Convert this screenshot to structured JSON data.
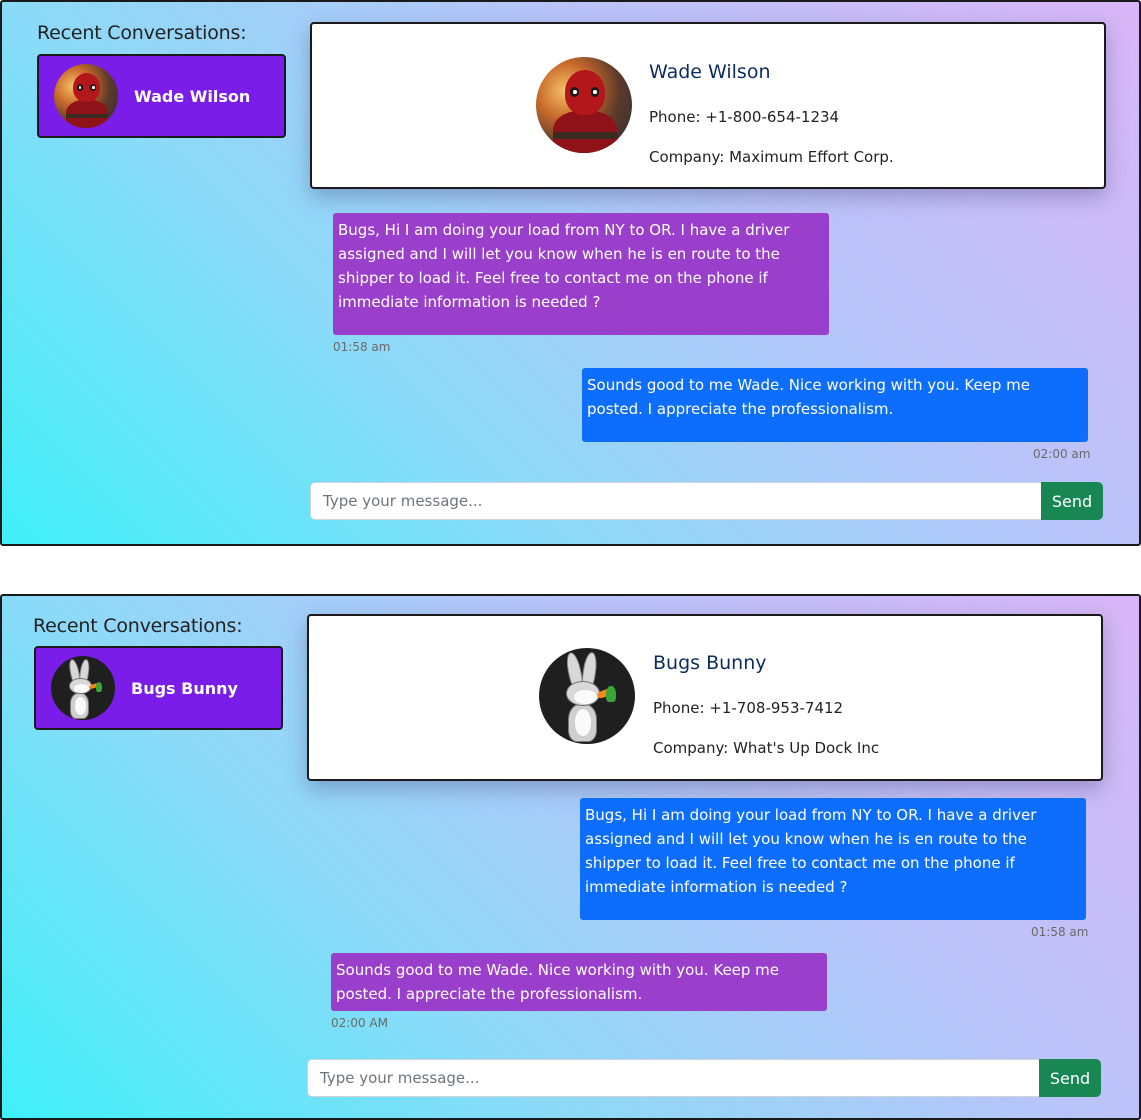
{
  "panels": [
    {
      "recent_title": "Recent Conversations:",
      "conversation": {
        "name": "Wade Wilson",
        "avatar": "deadpool-avatar"
      },
      "profile": {
        "name": "Wade Wilson",
        "phone": "Phone: +1-800-654-1234",
        "company": "Company: Maximum Effort Corp."
      },
      "messages": [
        {
          "text": "Bugs, Hi I am doing your load from NY to OR. I have a driver assigned and I will let you know when he is en route to the shipper to load it. Feel free to contact me on the phone if immediate information is needed ?",
          "time": "01:58 am",
          "side": "left",
          "color": "#9a3fcb"
        },
        {
          "text": "Sounds good to me Wade. Nice working with you. Keep me posted. I appreciate the professionalism.",
          "time": "02:00 am",
          "side": "right",
          "color": "#0d6efd"
        }
      ],
      "input": {
        "placeholder": "Type your message...",
        "value": ""
      },
      "send_label": "Send"
    },
    {
      "recent_title": "Recent Conversations:",
      "conversation": {
        "name": "Bugs Bunny",
        "avatar": "bugs-bunny-avatar"
      },
      "profile": {
        "name": "Bugs Bunny",
        "phone": "Phone: +1-708-953-7412",
        "company": "Company: What's Up Dock Inc"
      },
      "messages": [
        {
          "text": "Bugs, Hi I am doing your load from NY to OR. I have a driver assigned and I will let you know when he is en route to the shipper to load it. Feel free to contact me on the phone if immediate information is needed ?",
          "time": "01:58 am",
          "side": "right",
          "color": "#0d6efd"
        },
        {
          "text": "Sounds good to me Wade. Nice working with you. Keep me posted. I appreciate the professionalism.",
          "time": "02:00 AM",
          "side": "left",
          "color": "#9a3fcb"
        }
      ],
      "input": {
        "placeholder": "Type your message...",
        "value": ""
      },
      "send_label": "Send"
    }
  ],
  "colors": {
    "conversation_item": "#7b1de8",
    "send_button": "#198754",
    "profile_name": "#0b2c5e"
  }
}
